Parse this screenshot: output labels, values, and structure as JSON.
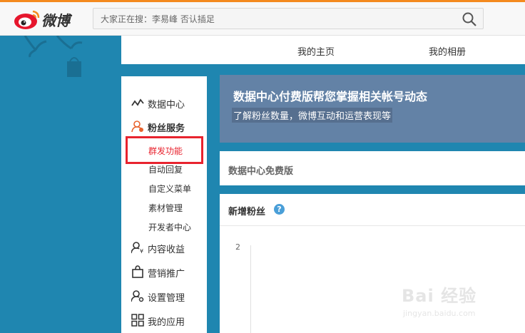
{
  "header": {
    "logo_text": "微博",
    "search_placeholder": "大家正在搜：李易峰 否认插足"
  },
  "nav": {
    "home": "我的主页",
    "album": "我的相册"
  },
  "sidebar": {
    "items": [
      {
        "label": "数据中心"
      },
      {
        "label": "粉丝服务"
      },
      {
        "label": "内容收益"
      },
      {
        "label": "营销推广"
      },
      {
        "label": "设置管理"
      },
      {
        "label": "我的应用"
      }
    ],
    "sub_items": [
      "群发功能",
      "自动回复",
      "自定义菜单",
      "素材管理",
      "开发者中心"
    ]
  },
  "banner": {
    "title": "数据中心付费版帮您掌握相关帐号动态",
    "subtitle": "了解粉丝数量，微博互动和运营表现等"
  },
  "free_section": {
    "title": "数据中心免费版"
  },
  "fans_section": {
    "title": "新增粉丝",
    "help_icon": "?",
    "y_tick": "2"
  },
  "watermark": {
    "main": "Bai 经验",
    "sub": "jingyan.baidu.com"
  },
  "colors": {
    "background": "#1f86b0",
    "highlight": "#e8232e",
    "banner": "#6382a6",
    "top_strip": "#f48a1f"
  }
}
